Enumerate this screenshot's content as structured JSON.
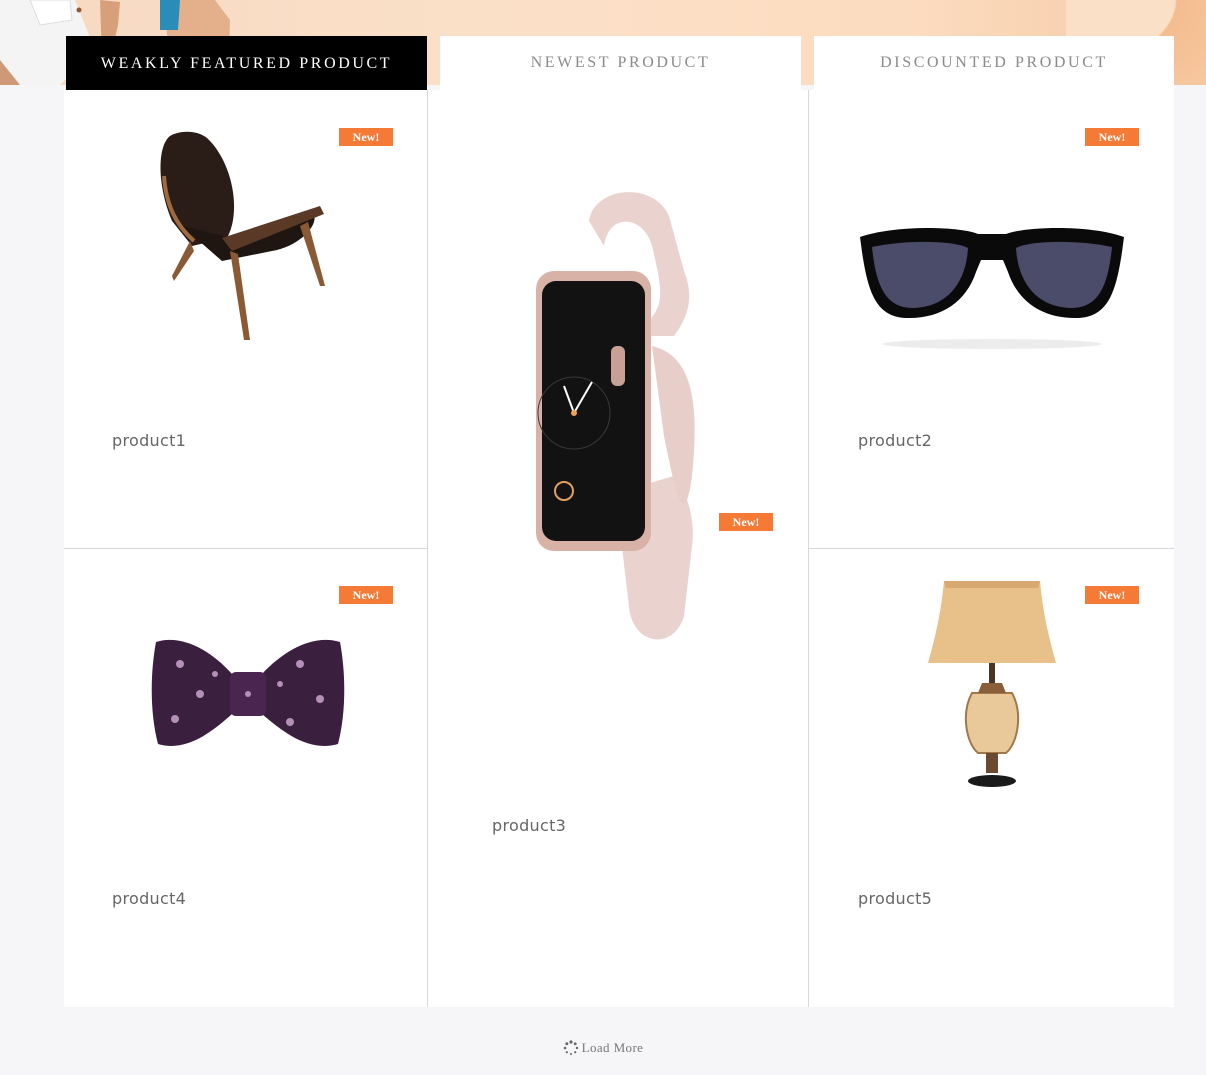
{
  "tabs": [
    {
      "label": "WEAKLY FEATURED PRODUCT",
      "active": true
    },
    {
      "label": "NEWEST PRODUCT",
      "active": false
    },
    {
      "label": "DISCOUNTED PRODUCT",
      "active": false
    }
  ],
  "products": [
    {
      "name": "product1",
      "badge": "New!",
      "icon": "lounge-chair-image"
    },
    {
      "name": "product2",
      "badge": "New!",
      "icon": "sunglasses-image"
    },
    {
      "name": "product3",
      "badge": "New!",
      "icon": "smartwatch-image"
    },
    {
      "name": "product4",
      "badge": "New!",
      "icon": "bow-tie-image"
    },
    {
      "name": "product5",
      "badge": "New!",
      "icon": "table-lamp-image"
    }
  ],
  "load_more": {
    "label": "Load More"
  },
  "colors": {
    "badge": "#f47a36",
    "active_tab": "#000000",
    "text": "#666666"
  }
}
